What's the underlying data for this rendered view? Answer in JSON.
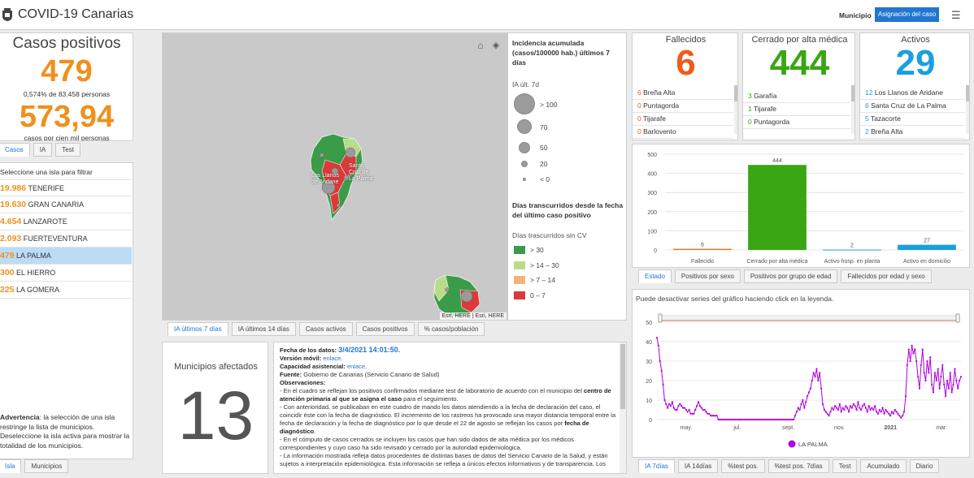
{
  "header": {
    "title": "COVID-19 Canarias",
    "municipio_label": "Municipio",
    "asignacion_button": "Asignación del caso"
  },
  "casos": {
    "title": "Casos positivos",
    "count": "479",
    "percent_text": "0,574% de 83.458 personas",
    "rate": "573,94",
    "rate_label": "casos por cien mil personas",
    "tabs": [
      "Casos",
      "IA",
      "Test"
    ]
  },
  "islands": {
    "header": "Seleccione una isla para filtrar",
    "items": [
      {
        "value": "19.986",
        "name": "TENERIFE"
      },
      {
        "value": "19.630",
        "name": "GRAN CANARIA"
      },
      {
        "value": "4.654",
        "name": "LANZAROTE"
      },
      {
        "value": "2.093",
        "name": "FUERTEVENTURA"
      },
      {
        "value": "479",
        "name": "LA PALMA"
      },
      {
        "value": "300",
        "name": "EL HIERRO"
      },
      {
        "value": "225",
        "name": "LA GOMERA"
      }
    ],
    "warning_bold": "Advertencia",
    "warning_text": ": la selección de una isla restringe la lista de municipios. Deseleccione la isla activa para mostrar la totalidad de los municipios.",
    "tabs": [
      "Isla",
      "Municipios"
    ]
  },
  "map": {
    "labels": {
      "llanos": "Los Llanos de Aridane",
      "santa_cruz": "Santa Cruz de La Palma"
    },
    "attribution": "Esri, HERE | Esri, HERE",
    "tabs": [
      "IA últimos 7 días",
      "IA últimos 14 días",
      "Casos activos",
      "Casos positivos",
      "% casos/población"
    ]
  },
  "legend": {
    "title": "Incidencia acumulada (casos/100000 hab.) últimos 7 días",
    "ia_label": "IA últ. 7d",
    "circles": [
      "> 100",
      "70",
      "50",
      "20",
      "< 0"
    ],
    "days_title": "Días transcurridos desde la fecha del último caso positivo",
    "days_label": "Días trascurridos sin CV",
    "days_items": [
      {
        "label": "> 30",
        "color": "#3a9b48"
      },
      {
        "label": "> 14 – 30",
        "color": "#b8dd8a"
      },
      {
        "label": "> 7 – 14",
        "color": "#f4b27a"
      },
      {
        "label": "0 – 7",
        "color": "#dc3a3a"
      }
    ]
  },
  "municipios": {
    "title": "Municipios afectados",
    "count": "13"
  },
  "notes": {
    "fecha_label": "Fecha de los datos:",
    "fecha_value": "3/4/2021 14:01:50.",
    "movil_label": "Versión móvil:",
    "movil_link": "enlace",
    "capacidad_label": "Capacidad asistencial:",
    "capacidad_link": "enlace",
    "fuente_label": "Fuente:",
    "fuente_text": "Gobierno de Canarias (Servicio Canario de Salud)",
    "obs_label": "Observaciones:",
    "p1_a": "- En el cuadro se reflejan los positivos confirmados mediante test de laboratorio de acuerdo con el municipio del ",
    "p1_b": "centro de atención primaria al que se asigna el caso",
    "p1_c": " para el seguimiento.",
    "p2_a": "- Con anterioridad, se publicaban en este cuadro de mando los datos atendiendo a la fecha de declaración del caso, el coincidir éste con la fecha de diagnóstico. El incremento de los rastreos ha provocado una mayor distancia temporal entre la fecha de declaración y la fecha de diagnóstico por lo que desde el 22 de agosto se reflejan los casos por ",
    "p2_b": "fecha de diagnóstico",
    "p2_c": ".",
    "p3": "- En el cómputo de casos cerrados se incluyen los casos que han sido dados de alta médica por los médicos correspondientes y cuyo caso ha sido revisado y cerrado por la autoridad epidemiológica.",
    "p4": "- La información mostrada refleja datos procedentes de distintas bases de datos del Servicio Canario de la Salud, y están sujetos a interpretación epidemiológica. Esta información se refleja a únicos efectos informativos y de transparencia. Los"
  },
  "fallecidos": {
    "title": "Fallecidos",
    "count": "6",
    "items": [
      {
        "value": "6",
        "name": "Breña Alta"
      },
      {
        "value": "0",
        "name": "Puntagorda"
      },
      {
        "value": "0",
        "name": "Tijarafe"
      },
      {
        "value": "0",
        "name": "Barlovento"
      }
    ]
  },
  "cerrado": {
    "title": "Cerrado por alta médica",
    "count": "444",
    "items": [
      {
        "value": "3",
        "name": "Garafía"
      },
      {
        "value": "1",
        "name": "Tijarafe"
      },
      {
        "value": "0",
        "name": "Puntagorda"
      }
    ]
  },
  "activos": {
    "title": "Activos",
    "count": "29",
    "items": [
      {
        "value": "12",
        "name": "Los Llanos de Aridane"
      },
      {
        "value": "6",
        "name": "Santa Cruz de La Palma"
      },
      {
        "value": "5",
        "name": "Tazacorte"
      },
      {
        "value": "2",
        "name": "Breña Alta"
      }
    ]
  },
  "estado_tabs": [
    "Estado",
    "Positivos por sexo",
    "Positivos por grupo de edad",
    "Fallecidos por edad y sexo"
  ],
  "series_tabs": [
    "IA 7días",
    "IA 14días",
    "%test pos.",
    "%test pos. 7días",
    "Test",
    "Acumulado",
    "Diario"
  ],
  "series_hint": "Puede desactivar series del gráfico haciendo click en la leyenda.",
  "colors": {
    "accent": "#2176d2",
    "orange": "#f0901c",
    "red": "#f05a1a",
    "green": "#3aa614",
    "cyan": "#1a9fe0",
    "purple": "#b000e0"
  },
  "chart_data": [
    {
      "type": "bar",
      "categories": [
        "Fallecido",
        "Cerrado por alta médica",
        "Activo hosp. en planta",
        "Activo en domicilio"
      ],
      "values": [
        6,
        444,
        2,
        27
      ],
      "colors": [
        "#e07a2a",
        "#3aa614",
        "#1a9fe0",
        "#1a9fe0"
      ],
      "ylim": [
        0,
        500
      ],
      "yticks": [
        0,
        100,
        200,
        300,
        400,
        500
      ],
      "grid": true
    },
    {
      "type": "line",
      "series": [
        {
          "name": "LA PALMA",
          "color": "#b000e0"
        }
      ],
      "ylim": [
        0,
        50
      ],
      "yticks": [
        0,
        10,
        20,
        30,
        40,
        50
      ],
      "xticks": [
        "may.",
        "jul.",
        "sept.",
        "nov.",
        "2021",
        "mar."
      ],
      "values": [
        42,
        38,
        30,
        25,
        18,
        10,
        8,
        6,
        8,
        7,
        9,
        6,
        5,
        5,
        7,
        8,
        7,
        6,
        6,
        5,
        4,
        5,
        3,
        3,
        3,
        5,
        7,
        9,
        7,
        6,
        5,
        5,
        4,
        3,
        3,
        2,
        2,
        2,
        2,
        2,
        0,
        0,
        0,
        0,
        0,
        0,
        0,
        0,
        0,
        0,
        0,
        0,
        0,
        0,
        0,
        0,
        0,
        0,
        0,
        0,
        0,
        0,
        0,
        0,
        0,
        0,
        0,
        0,
        0,
        0,
        0,
        0,
        0,
        0,
        0,
        0,
        0,
        0,
        0,
        0,
        0,
        0,
        0,
        0,
        0,
        0,
        0,
        0,
        0,
        0,
        2,
        4,
        6,
        5,
        8,
        10,
        6,
        9,
        12,
        14,
        16,
        20,
        24,
        22,
        26,
        20,
        24,
        16,
        8,
        5,
        4,
        3,
        2,
        4,
        6,
        5,
        7,
        6,
        5,
        8,
        4,
        6,
        5,
        7,
        6,
        4,
        7,
        6,
        8,
        7,
        5,
        9,
        6,
        5,
        7,
        8,
        6,
        4,
        7,
        5,
        6,
        5,
        7,
        4,
        3,
        5,
        4,
        6,
        3,
        5,
        4,
        3,
        2,
        4,
        3,
        5,
        4,
        3,
        2,
        1,
        2,
        4,
        12,
        28,
        36,
        30,
        38,
        34,
        36,
        30,
        22,
        16,
        28,
        36,
        24,
        20,
        30,
        24,
        32,
        18,
        14,
        24,
        20,
        26,
        16,
        22,
        28,
        18,
        12,
        20,
        16,
        24,
        14,
        18,
        26,
        20,
        16,
        20,
        22
      ]
    }
  ]
}
